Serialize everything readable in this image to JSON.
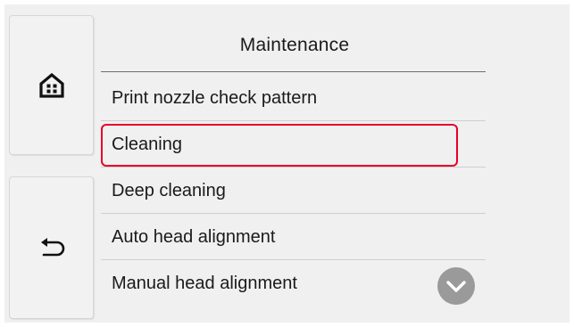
{
  "screen": {
    "title": "Maintenance",
    "menu_items": [
      {
        "label": "Print nozzle check pattern",
        "highlighted": false
      },
      {
        "label": "Cleaning",
        "highlighted": true
      },
      {
        "label": "Deep cleaning",
        "highlighted": false
      },
      {
        "label": "Auto head alignment",
        "highlighted": false
      },
      {
        "label": "Manual head alignment",
        "highlighted": false
      }
    ]
  },
  "side_buttons": {
    "home_icon": "home-icon",
    "back_icon": "back-arrow-icon"
  },
  "scroll": {
    "icon": "chevron-down-icon"
  },
  "colors": {
    "highlight_border": "#e8002a",
    "screen_background": "#f0f0f0",
    "scroll_button": "#9a9a9a"
  }
}
